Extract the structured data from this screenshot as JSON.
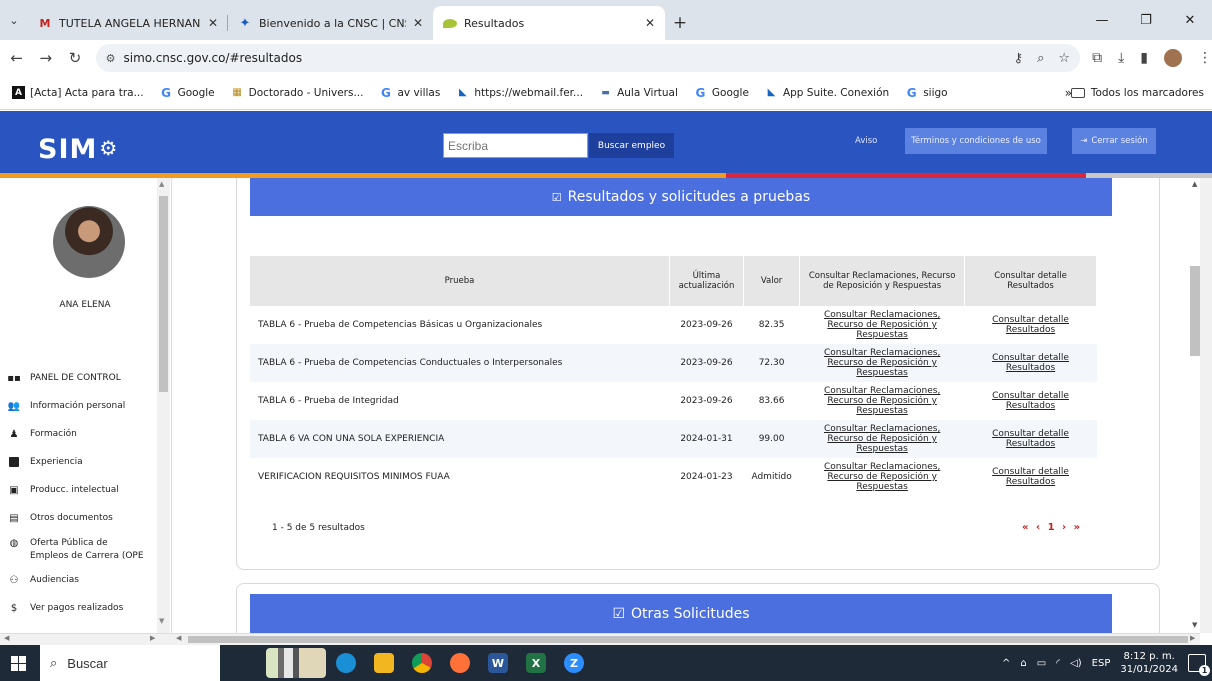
{
  "browser": {
    "tabs": [
      {
        "title": "TUTELA ANGELA HERNANDEZ",
        "icon": "gmail-icon"
      },
      {
        "title": "Bienvenido a la CNSC | CNSC",
        "icon": "cnsc-icon"
      },
      {
        "title": "Resultados",
        "icon": "simo-leaf-icon"
      }
    ],
    "url": "simo.cnsc.gov.co/#resultados",
    "bookmarks": [
      {
        "label": "[Acta] Acta para tra...",
        "icon": "A"
      },
      {
        "label": "Google",
        "icon": "G"
      },
      {
        "label": "Doctorado - Univers...",
        "icon": "D"
      },
      {
        "label": "av villas",
        "icon": "G"
      },
      {
        "label": "https://webmail.fer...",
        "icon": "M"
      },
      {
        "label": "Aula Virtual",
        "icon": "AV"
      },
      {
        "label": "Google",
        "icon": "G"
      },
      {
        "label": "App Suite. Conexión",
        "icon": "M"
      },
      {
        "label": "siigo",
        "icon": "G"
      }
    ],
    "bookmarks_more": "»",
    "all_bookmarks": "Todos los marcadores"
  },
  "site": {
    "logo": "SIM",
    "search_placeholder": "Escriba",
    "search_button": "Buscar empleo",
    "aviso": "Aviso",
    "terms": "Términos y condiciones de uso",
    "logout": "Cerrar sesión"
  },
  "sidebar": {
    "user_name": "ANA ELENA",
    "items": [
      {
        "label": "PANEL DE CONTROL",
        "icon": "dashboard-icon"
      },
      {
        "label": "Información personal",
        "icon": "people-icon"
      },
      {
        "label": "Formación",
        "icon": "graduation-icon"
      },
      {
        "label": "Experiencia",
        "icon": "briefcase-icon"
      },
      {
        "label": "Producc. intelectual",
        "icon": "book-icon"
      },
      {
        "label": "Otros documentos",
        "icon": "document-icon"
      },
      {
        "label": "Oferta Pública de",
        "label2": "Empleos de Carrera (OPE",
        "icon": "globe-icon"
      },
      {
        "label": "Audiencias",
        "icon": "audience-icon"
      },
      {
        "label": "Ver pagos realizados",
        "icon": "dollar-icon"
      }
    ]
  },
  "results": {
    "section_title": "Resultados y solicitudes a pruebas",
    "columns": [
      "Prueba",
      "Última actualización",
      "Valor",
      "Consultar Reclamaciones, Recurso de Reposición y Respuestas",
      "Consultar detalle Resultados"
    ],
    "rows": [
      {
        "prueba": "TABLA 6 - Prueba de Competencias Básicas u Organizacionales",
        "fecha": "2023-09-26",
        "valor": "82.35",
        "reclamaciones": "Consultar Reclamaciones, Recurso de Reposición y Respuestas",
        "detalle": "Consultar detalle Resultados"
      },
      {
        "prueba": "TABLA 6 - Prueba de Competencias Conductuales o Interpersonales",
        "fecha": "2023-09-26",
        "valor": "72.30",
        "reclamaciones": "Consultar Reclamaciones, Recurso de Reposición y Respuestas",
        "detalle": "Consultar detalle Resultados"
      },
      {
        "prueba": "TABLA 6 - Prueba de Integridad",
        "fecha": "2023-09-26",
        "valor": "83.66",
        "reclamaciones": "Consultar Reclamaciones, Recurso de Reposición y Respuestas",
        "detalle": "Consultar detalle Resultados"
      },
      {
        "prueba": "TABLA 6 VA CON UNA SOLA EXPERIENCIA",
        "fecha": "2024-01-31",
        "valor": "99.00",
        "reclamaciones": "Consultar Reclamaciones, Recurso de Reposición y Respuestas",
        "detalle": "Consultar detalle Resultados"
      },
      {
        "prueba": "VERIFICACION REQUISITOS MINIMOS FUAA",
        "fecha": "2024-01-23",
        "valor": "Admitido",
        "reclamaciones": "Consultar Reclamaciones, Recurso de Reposición y Respuestas",
        "detalle": "Consultar detalle Resultados"
      }
    ],
    "pager_text": "1 - 5 de 5 resultados",
    "pager_first": "«",
    "pager_prev": "‹",
    "pager_page": "1",
    "pager_next": "›",
    "pager_last": "»"
  },
  "otras": {
    "title": "Otras Solicitudes"
  },
  "taskbar": {
    "search_label": "Buscar",
    "time": "8:12 p. m.",
    "date": "31/01/2024",
    "lang": "ESP",
    "notifications": "1"
  }
}
